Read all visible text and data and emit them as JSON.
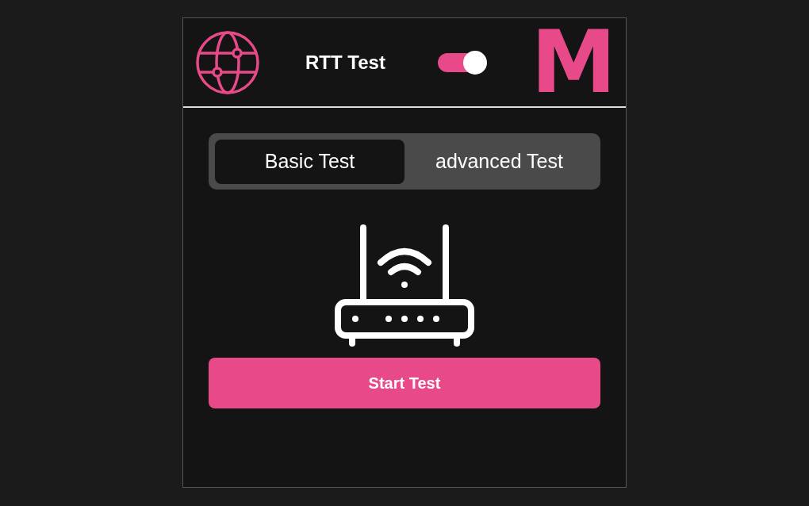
{
  "header": {
    "title": "RTT Test",
    "toggle": {
      "on": true
    },
    "logo": "M"
  },
  "tabs": [
    {
      "label": "Basic Test",
      "selected": true
    },
    {
      "label": "advanced Test",
      "selected": false
    }
  ],
  "start_button": "Start Test"
}
